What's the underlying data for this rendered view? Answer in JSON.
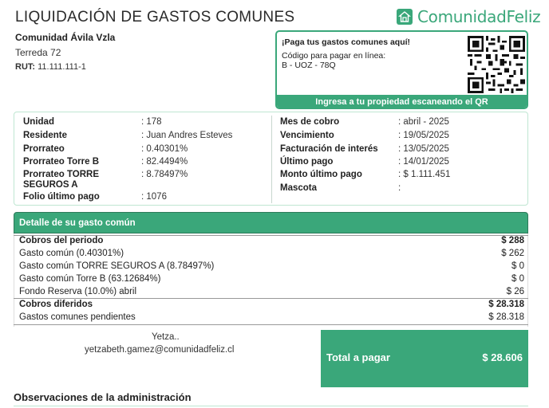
{
  "header": {
    "title": "LIQUIDACIÓN DE GASTOS COMUNES",
    "logo_text": "ComunidadFeliz",
    "brand_color": "#3aa77a"
  },
  "community": {
    "name": "Comunidad  Ávila Vzla",
    "address": "Terreda 72",
    "rut_label": "RUT:",
    "rut_value": "11.111.111-1"
  },
  "qr_panel": {
    "heading": "¡Paga tus gastos comunes aquí!",
    "code_label": "Código para pagar en línea:",
    "code_value": "B - UOZ - 78Q",
    "footer": "Ingresa a tu propiedad escaneando el QR",
    "icon": "qr-code-icon"
  },
  "unit_info": {
    "left": [
      {
        "label": "Unidad",
        "value": ": 178"
      },
      {
        "label": "Residente",
        "value": ": Juan Andres Esteves"
      },
      {
        "label": "Prorrateo",
        "value": ": 0.40301%"
      },
      {
        "label": "Prorrateo Torre B",
        "value": ": 82.4494%"
      },
      {
        "label": "Prorrateo TORRE",
        "label2": "SEGUROS A",
        "value": ": 8.78497%"
      },
      {
        "label": "Folio último pago",
        "value": ": 1076"
      }
    ],
    "right": [
      {
        "label": "Mes de cobro",
        "value": ": abril - 2025"
      },
      {
        "label": "Vencimiento",
        "value": ": 19/05/2025"
      },
      {
        "label": "Facturación de interés",
        "value": ": 13/05/2025"
      },
      {
        "label": "Último pago",
        "value": ": 14/01/2025"
      },
      {
        "label": "Monto último pago",
        "value": ": $ 1.111.451"
      },
      {
        "label": "Mascota",
        "value": ":"
      }
    ]
  },
  "detail": {
    "heading": "Detalle de su gasto común",
    "rows": [
      {
        "label": "Cobros del periodo",
        "amount": "$ 288",
        "bold": true
      },
      {
        "label": "Gasto común (0.40301%)",
        "amount": "$ 262",
        "bold": false
      },
      {
        "label": "Gasto común TORRE SEGUROS A (8.78497%)",
        "amount": "$ 0",
        "bold": false
      },
      {
        "label": "Gasto común Torre B (63.12684%)",
        "amount": "$ 0",
        "bold": false
      },
      {
        "label": "Fondo Reserva (10.0%) abril",
        "amount": "$ 26",
        "bold": false
      },
      {
        "label": "Cobros diferidos",
        "amount": "$ 28.318",
        "bold": true
      },
      {
        "label": "Gastos comunes pendientes",
        "amount": "$ 28.318",
        "bold": false
      }
    ]
  },
  "contact": {
    "name": "Yetza..",
    "email": "yetzabeth.gamez@comunidadfeliz.cl"
  },
  "total": {
    "label": "Total a pagar",
    "amount": "$ 28.606"
  },
  "observations": {
    "heading": "Observaciones de la administración"
  }
}
